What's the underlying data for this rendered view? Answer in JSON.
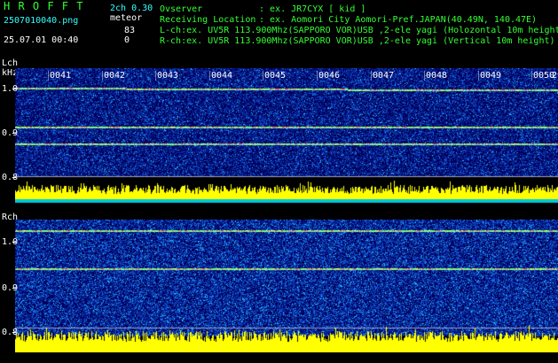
{
  "header": {
    "app_title": "H R O F F T",
    "mode": "2ch 0.30",
    "filename": "2507010040.png",
    "meteor_label": "meteor",
    "lch_count": "83",
    "datetime": "25.07.01 00:40",
    "rch_count": "0",
    "observer_label": "Ovserver",
    "observer_value": ": ex. JR7CYX [ kid ]",
    "location_label": "Receiving Location",
    "location_value": ": ex. Aomori City Aomori-Pref.JAPAN(40.49N, 140.47E)",
    "lch_desc": "L-ch:ex. UV5R 113.900Mhz(SAPPORO VOR)USB ,2-ele yagi (Holozontal 10m height)",
    "rch_desc": "R-ch:ex. UV5R 113.900Mhz(SAPPORO VOR)USB ,2-ele yagi (Vertical 10m height)"
  },
  "lch": {
    "label": "Lch",
    "unit": "kHz",
    "ticks": [
      "1.0",
      "0.9",
      "0.8"
    ],
    "time_labels": [
      "0041",
      "0042",
      "0043",
      "0044",
      "0045",
      "0046",
      "0047",
      "0048",
      "0049",
      "0050"
    ],
    "edge_label": "2"
  },
  "rch": {
    "label": "Rch",
    "ticks": [
      "1.0",
      "0.9",
      "0.8"
    ]
  },
  "colors": {
    "text_green": "#33ff33",
    "text_cyan": "#33ffff",
    "background": "#000000",
    "spectrum_dark": "#000064",
    "level_bar": "#ffff00"
  }
}
